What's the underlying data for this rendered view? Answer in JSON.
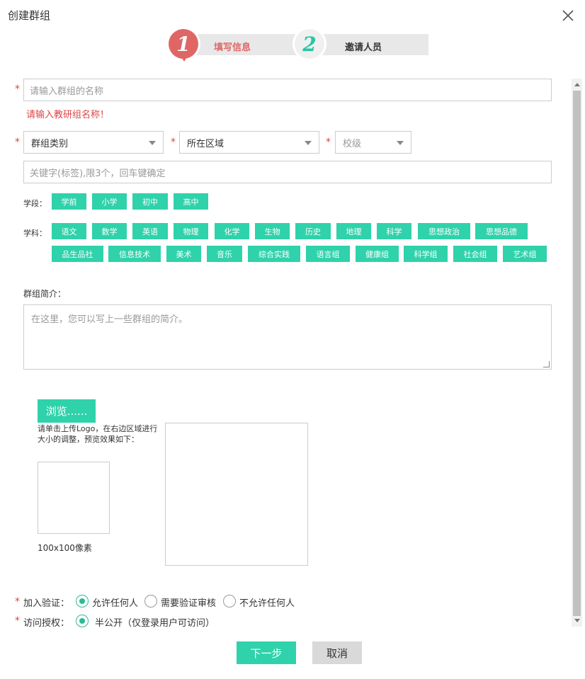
{
  "dialog": {
    "title": "创建群组"
  },
  "steps": [
    {
      "number": "1",
      "label": "填写信息"
    },
    {
      "number": "2",
      "label": "邀请人员"
    }
  ],
  "form": {
    "name_placeholder": "请输入群组的名称",
    "name_error": "请输入教研组名称！",
    "required_mark": "*",
    "category_select": "群组类别",
    "region_select": "所在区域",
    "school_select": "校级",
    "keywords_placeholder": "关键字(标签),限3个，回车键确定",
    "stage_label": "学段：",
    "stages": [
      "学前",
      "小学",
      "初中",
      "高中"
    ],
    "subject_label": "学科：",
    "subjects_row1": [
      "语文",
      "数学",
      "英语",
      "物理",
      "化学",
      "生物",
      "历史",
      "地理",
      "科学",
      "思想政治",
      "思想品德"
    ],
    "subjects_row2": [
      "品生品社",
      "信息技术",
      "美术",
      "音乐",
      "综合实践",
      "语言组",
      "健康组",
      "科学组",
      "社会组",
      "艺术组"
    ],
    "intro_label": "群组简介：",
    "intro_placeholder": "在这里，您可以写上一些群组的简介。",
    "browse_button": "浏览......",
    "logo_hint": "请单击上传Logo，在右边区域进行大小的调整，预览效果如下：",
    "logo_size": "100x100像素",
    "join_label": "加入验证：",
    "join_options": [
      "允许任何人",
      "需要验证审核",
      "不允许任何人"
    ],
    "access_label": "访问授权：",
    "access_options": [
      "半公开（仅登录用户可访问）"
    ]
  },
  "buttons": {
    "next": "下一步",
    "cancel": "取消"
  },
  "colors": {
    "accent": "#2fd2aa",
    "error": "#e04444",
    "step_active": "#e06666"
  }
}
